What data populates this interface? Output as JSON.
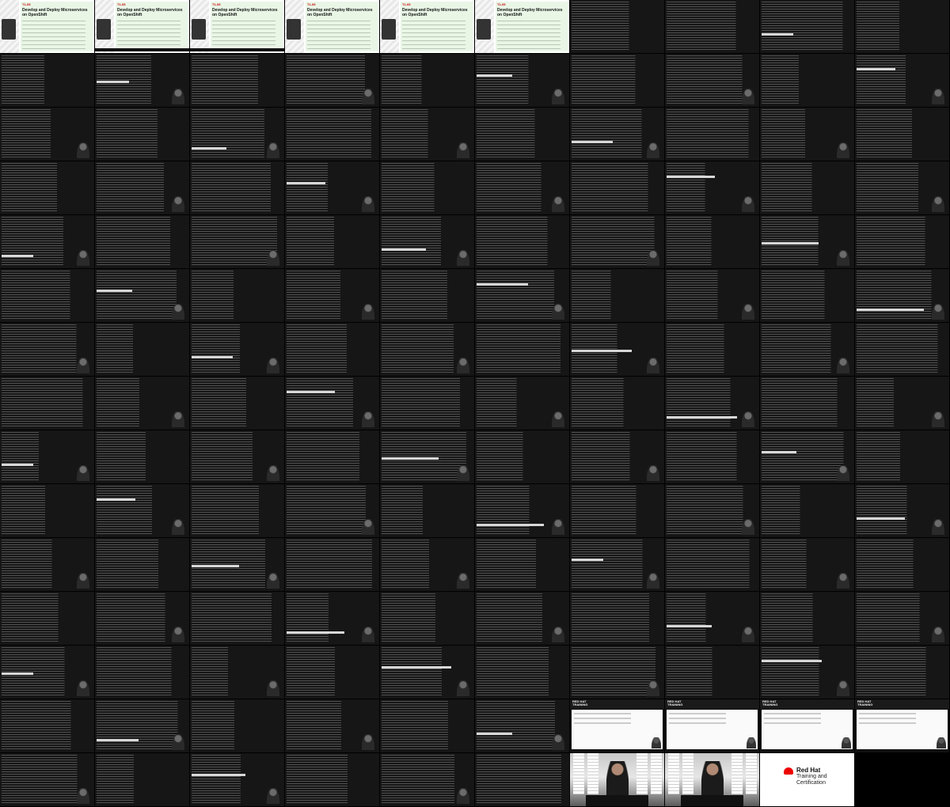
{
  "sheet": {
    "columns": 10,
    "rows": 15,
    "background": "#000000"
  },
  "slide": {
    "tag": "T1-05",
    "title": "Develop and Deploy Microservices on OpenShift",
    "panel_color": "#e9f6e6"
  },
  "web": {
    "header": "RED HAT\nTRAINING",
    "header_color": "#1a1a1a"
  },
  "logo": {
    "brand": "Red Hat",
    "tagline": "Training and Certification",
    "brand_color": "#ee0000",
    "icon": "red-hat-logo-icon"
  },
  "terminal": {
    "background": "#161616",
    "text_color": "#9a9a9a"
  }
}
